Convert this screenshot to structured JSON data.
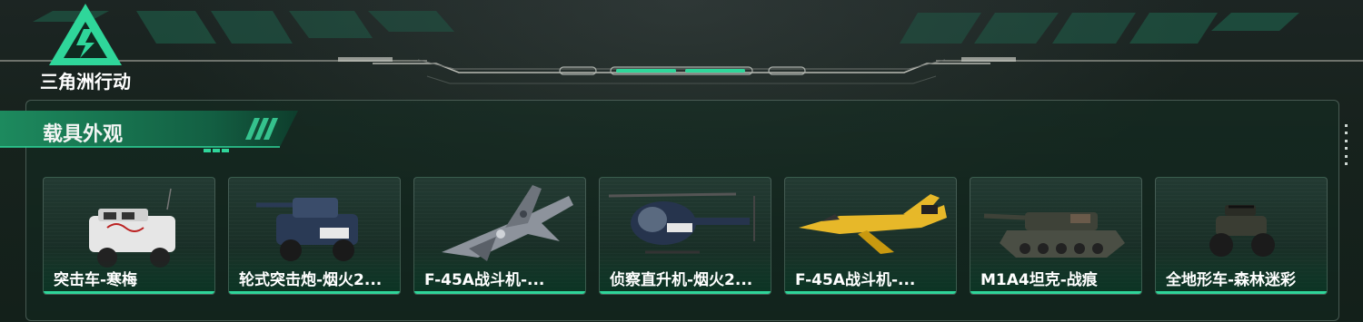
{
  "brand": {
    "logo_text": "三角洲行动"
  },
  "section": {
    "title": "载具外观"
  },
  "cards": [
    {
      "label": "突击车-寒梅",
      "icon": "armored-car-icon"
    },
    {
      "label": "轮式突击炮-烟火2...",
      "icon": "wheeled-assault-gun-icon"
    },
    {
      "label": "F-45A战斗机-...",
      "icon": "fighter-jet-camo-icon"
    },
    {
      "label": "侦察直升机-烟火2...",
      "icon": "helicopter-icon"
    },
    {
      "label": "F-45A战斗机-...",
      "icon": "fighter-jet-yellow-icon"
    },
    {
      "label": "M1A4坦克-战痕",
      "icon": "tank-icon"
    },
    {
      "label": "全地形车-森林迷彩",
      "icon": "atv-icon"
    }
  ],
  "colors": {
    "accent": "#2fd69a",
    "background": "#142019"
  }
}
